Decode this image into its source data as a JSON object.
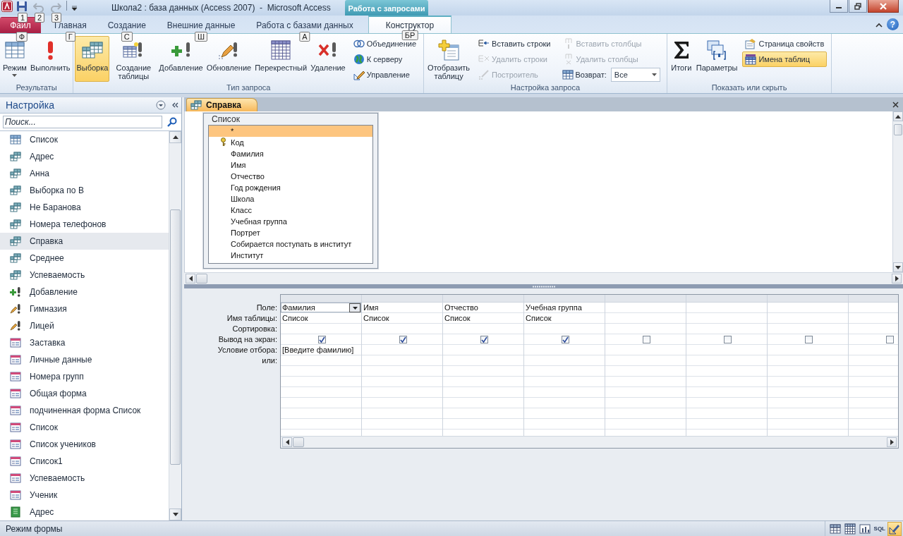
{
  "title_bar": {
    "title": "Школа2 : база данных (Access 2007)  -  Microsoft Access",
    "context_tab": "Работа с запросами",
    "quick_access": [
      {
        "kind": "save",
        "keytip": "1",
        "disabled": false
      },
      {
        "kind": "undo",
        "keytip": "2",
        "disabled": true
      },
      {
        "kind": "redo",
        "keytip": "3",
        "disabled": true
      }
    ]
  },
  "tabs": [
    {
      "label": "Файл",
      "kind": "file",
      "keytip": "Ф",
      "selected": false
    },
    {
      "label": "Главная",
      "kind": "tab",
      "keytip": "Г",
      "selected": false
    },
    {
      "label": "Создание",
      "kind": "tab",
      "keytip": "С",
      "selected": false
    },
    {
      "label": "Внешние данные",
      "kind": "tab",
      "keytip": "Ш",
      "selected": false
    },
    {
      "label": "Работа с базами данных",
      "kind": "tab",
      "keytip": "А",
      "selected": false
    },
    {
      "label": "Конструктор",
      "kind": "tab",
      "keytip": "БР",
      "selected": true
    }
  ],
  "help": {
    "label": "?"
  },
  "ribbon": {
    "groups": [
      {
        "label": "Результаты",
        "items": [
          {
            "kind": "large",
            "label": "Режим",
            "dropdown": true,
            "selected": false,
            "disabled": false
          },
          {
            "kind": "large",
            "label": "Выполнить",
            "dropdown": false,
            "selected": false,
            "disabled": false
          }
        ]
      },
      {
        "label": "Тип запроса",
        "items": [
          {
            "kind": "large",
            "label": "Выборка",
            "dropdown": false,
            "selected": true,
            "disabled": false
          },
          {
            "kind": "large",
            "label": "Создание таблицы",
            "dropdown": false,
            "selected": false,
            "disabled": false
          },
          {
            "kind": "large",
            "label": "Добавление",
            "dropdown": false,
            "selected": false,
            "disabled": false
          },
          {
            "kind": "large",
            "label": "Обновление",
            "dropdown": false,
            "selected": false,
            "disabled": false
          },
          {
            "kind": "large",
            "label": "Перекрестный",
            "dropdown": false,
            "selected": false,
            "disabled": false
          },
          {
            "kind": "large",
            "label": "Удаление",
            "dropdown": false,
            "selected": false,
            "disabled": false
          },
          {
            "kind": "small",
            "label": "Объединение",
            "selected": false,
            "disabled": false
          },
          {
            "kind": "small",
            "label": "К серверу",
            "selected": false,
            "disabled": false
          },
          {
            "kind": "small",
            "label": "Управление",
            "selected": false,
            "disabled": false
          }
        ]
      },
      {
        "label": "Настройка запроса",
        "items": [
          {
            "kind": "large",
            "label": "Отобразить таблицу",
            "dropdown": false,
            "selected": false,
            "disabled": false
          },
          {
            "kind": "small",
            "label": "Вставить строки",
            "selected": false,
            "disabled": false
          },
          {
            "kind": "small",
            "label": "Удалить строки",
            "selected": false,
            "disabled": true
          },
          {
            "kind": "small",
            "label": "Построитель",
            "selected": false,
            "disabled": true
          },
          {
            "kind": "small",
            "label": "Вставить столбцы",
            "selected": false,
            "disabled": true
          },
          {
            "kind": "small",
            "label": "Удалить столбцы",
            "selected": false,
            "disabled": true
          },
          {
            "kind": "combo",
            "label": "Возврат:",
            "value": "Все"
          }
        ]
      },
      {
        "label": "Показать или скрыть",
        "items": [
          {
            "kind": "large",
            "label": "Итоги",
            "dropdown": false,
            "selected": false,
            "disabled": false
          },
          {
            "kind": "large",
            "label": "Параметры",
            "dropdown": false,
            "selected": false,
            "disabled": false
          },
          {
            "kind": "small",
            "label": "Страница свойств",
            "selected": false,
            "disabled": false
          },
          {
            "kind": "small",
            "label": "Имена таблиц",
            "selected": true,
            "disabled": false
          }
        ]
      }
    ]
  },
  "navigation": {
    "title": "Настройка",
    "search": {
      "placeholder": "Поиск..."
    },
    "items": [
      {
        "label": "Список",
        "kind": "table",
        "selected": false
      },
      {
        "label": "Адрес",
        "kind": "query",
        "selected": false
      },
      {
        "label": "Анна",
        "kind": "query",
        "selected": false
      },
      {
        "label": "Выборка по В",
        "kind": "query",
        "selected": false
      },
      {
        "label": "Не Баранова",
        "kind": "query",
        "selected": false
      },
      {
        "label": "Номера телефонов",
        "kind": "query",
        "selected": false
      },
      {
        "label": "Справка",
        "kind": "query",
        "selected": true
      },
      {
        "label": "Среднее",
        "kind": "query",
        "selected": false
      },
      {
        "label": "Успеваемость",
        "kind": "query",
        "selected": false
      },
      {
        "label": "Добавление",
        "kind": "append",
        "selected": false
      },
      {
        "label": "Гимназия",
        "kind": "update",
        "selected": false
      },
      {
        "label": "Лицей",
        "kind": "update",
        "selected": false
      },
      {
        "label": "Заставка",
        "kind": "form",
        "selected": false
      },
      {
        "label": "Личные данные",
        "kind": "form",
        "selected": false
      },
      {
        "label": "Номера групп",
        "kind": "form",
        "selected": false
      },
      {
        "label": "Общая форма",
        "kind": "form",
        "selected": false
      },
      {
        "label": "подчиненная форма Список",
        "kind": "form",
        "selected": false
      },
      {
        "label": "Список",
        "kind": "form",
        "selected": false
      },
      {
        "label": "Список учеников",
        "kind": "form",
        "selected": false
      },
      {
        "label": "Список1",
        "kind": "form",
        "selected": false
      },
      {
        "label": "Успеваемость",
        "kind": "form",
        "selected": false
      },
      {
        "label": "Ученик",
        "kind": "form",
        "selected": false
      },
      {
        "label": "Адрес",
        "kind": "report",
        "selected": false
      }
    ]
  },
  "document": {
    "tab": "Справка",
    "field_list": {
      "title": "Список",
      "fields": [
        {
          "label": "*",
          "key": false,
          "selected": true
        },
        {
          "label": "Код",
          "key": true,
          "selected": false
        },
        {
          "label": "Фамилия",
          "key": false,
          "selected": false
        },
        {
          "label": "Имя",
          "key": false,
          "selected": false
        },
        {
          "label": "Отчество",
          "key": false,
          "selected": false
        },
        {
          "label": "Год рождения",
          "key": false,
          "selected": false
        },
        {
          "label": "Школа",
          "key": false,
          "selected": false
        },
        {
          "label": "Класс",
          "key": false,
          "selected": false
        },
        {
          "label": "Учебная группа",
          "key": false,
          "selected": false
        },
        {
          "label": "Портрет",
          "key": false,
          "selected": false
        },
        {
          "label": "Собирается поступать в институт",
          "key": false,
          "selected": false
        },
        {
          "label": "Институт",
          "key": false,
          "selected": false
        }
      ]
    },
    "grid": {
      "row_labels": [
        "Поле:",
        "Имя таблицы:",
        "Сортировка:",
        "Вывод на экран:",
        "Условие отбора:",
        "или:"
      ],
      "columns": [
        {
          "field": "Фамилия",
          "table": "Список",
          "show": true,
          "criteria": "[Введите фамилию]",
          "selected": true
        },
        {
          "field": "Имя",
          "table": "Список",
          "show": true,
          "selected": false
        },
        {
          "field": "Отчество",
          "table": "Список",
          "show": true,
          "selected": false
        },
        {
          "field": "Учебная группа",
          "table": "Список",
          "show": true,
          "selected": false
        },
        {
          "show": false,
          "selected": false
        },
        {
          "show": false,
          "selected": false
        },
        {
          "show": false,
          "selected": false
        },
        {
          "show": false,
          "selected": false
        }
      ]
    }
  },
  "status_bar": {
    "text": "Режим формы",
    "views": [
      {
        "kind": "datasheet",
        "selected": false
      },
      {
        "kind": "pivottable",
        "selected": false
      },
      {
        "kind": "pivotchart",
        "selected": false
      },
      {
        "kind": "sql",
        "label": "SQL",
        "selected": false
      },
      {
        "kind": "design",
        "selected": true
      }
    ]
  }
}
